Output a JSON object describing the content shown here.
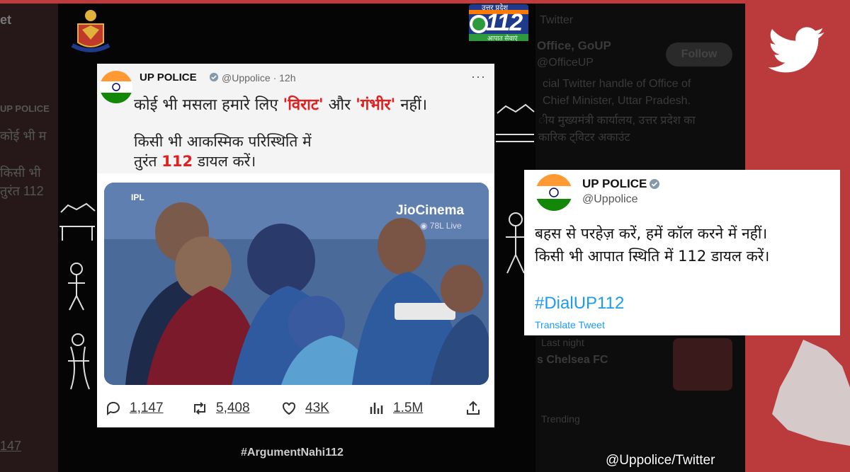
{
  "background": {
    "left_snippets": [
      "et",
      "UP POLICE",
      "कोई भी म",
      "किसी भी",
      "तुरंत 112",
      "147"
    ],
    "right_snippets": [
      "Twitter",
      "Office, GoUP",
      "@OfficeUP",
      "cial Twitter handle of Office of",
      "Chief Minister, Uttar Pradesh.",
      "ीय मुख्यमंत्री कार्यालय, उत्तर प्रदेश का",
      "कारिक ट्विटर अकाउंट",
      "Last night",
      "s Chelsea FC",
      "Trending"
    ],
    "follow_label": "Follow"
  },
  "logo112": {
    "top_text": "उत्तर प्रदेश",
    "number": "112",
    "bottom_text": "आपात सेवाएं"
  },
  "main_tweet": {
    "name": "UP POLICE",
    "handle": "@Uppolice · 12h",
    "more": "···",
    "line1_pre": "कोई भी मसला हमारे लिए ",
    "line1_red1": "'विराट'",
    "line1_mid": " और ",
    "line1_red2": "'गंभीर'",
    "line1_post": " नहीं।",
    "line2": "किसी भी आकस्मिक परिस्थिति में",
    "line3_pre": "तुरंत ",
    "line3_red": "112",
    "line3_post": " डायल करें।",
    "photo": {
      "broadcaster": "JioCinema",
      "live": "◉ 78L Live",
      "badge": "IPL"
    },
    "stats": {
      "replies": "1,147",
      "retweets": "5,408",
      "likes": "43K",
      "views": "1.5M"
    }
  },
  "hashtag_bottom": "#ArgumentNahi112",
  "overlay_tweet": {
    "name": "UP POLICE",
    "handle": "@Uppolice",
    "line1": "बहस से परहेज़ करें, हमें कॉल करने में नहीं।",
    "line2": "किसी भी आपात स्थिति में 112 डायल करें।",
    "hashtag": "#DialUP112",
    "translate": "Translate Tweet"
  },
  "credit": "@Uppolice/Twitter",
  "colors": {
    "frame_red": "#bf3b3c",
    "twitter_blue": "#1d9bf0",
    "accent_red": "#e02020"
  },
  "icons": [
    "twitter-bird-icon",
    "emblem-icon",
    "verified-icon",
    "reply-icon",
    "retweet-icon",
    "like-icon",
    "views-icon",
    "share-icon"
  ]
}
